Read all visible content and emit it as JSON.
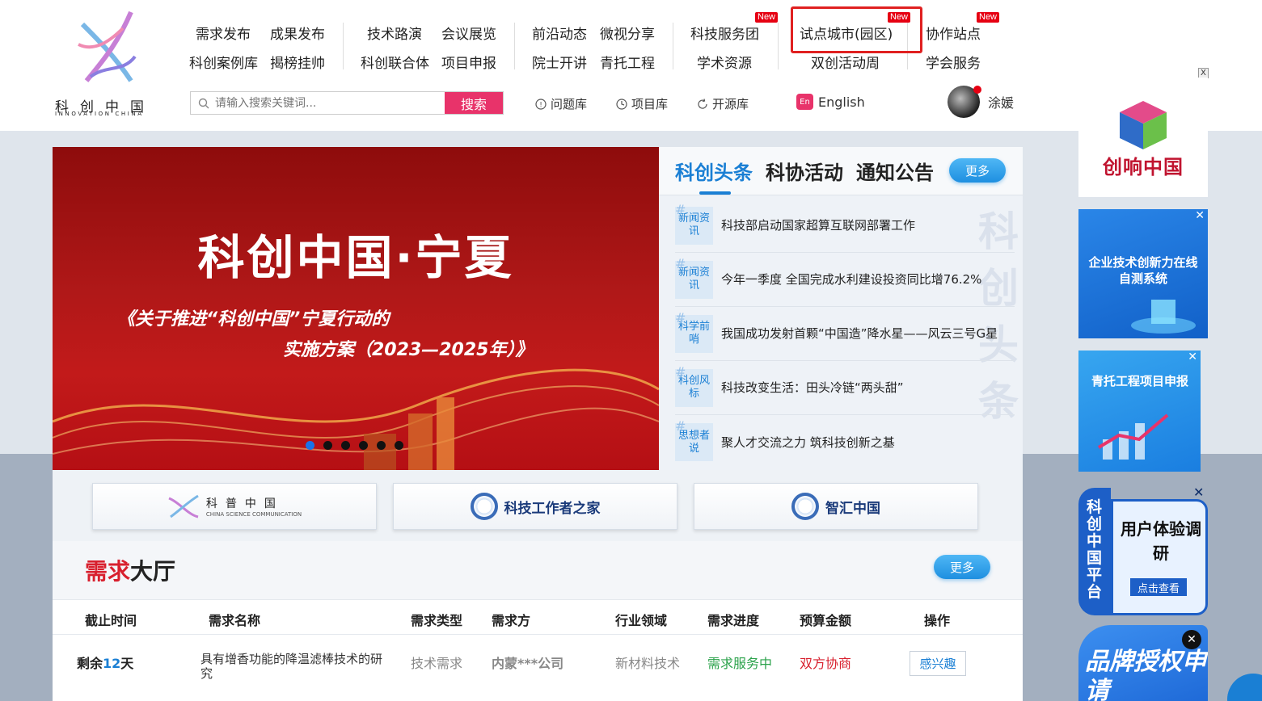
{
  "logo": {
    "cn": "科创中国",
    "en": "INNOVATION CHINA"
  },
  "nav": {
    "row1": [
      "需求发布",
      "成果发布",
      "技术路演",
      "会议展览",
      "前沿动态",
      "微视分享",
      "科技服务团",
      "试点城市(园区)",
      "协作站点"
    ],
    "row2": [
      "科创案例库",
      "揭榜挂帅",
      "科创联合体",
      "项目申报",
      "院士开讲",
      "青托工程",
      "学术资源",
      "双创活动周",
      "学会服务"
    ],
    "new_badge": "New"
  },
  "search": {
    "placeholder": "请输入搜索关键词...",
    "button": "搜索"
  },
  "libraries": [
    "问题库",
    "项目库",
    "开源库"
  ],
  "language": {
    "icon": "En",
    "label": "English"
  },
  "user": {
    "name": "涂媛"
  },
  "banner": {
    "title": "科创中国·宁夏",
    "subtitle_line1": "《关于推进“科创中国”宁夏行动的",
    "subtitle_line2": "实施方案（2023—2025年）》",
    "slide_count": 6,
    "active_slide": 0
  },
  "news": {
    "tabs": [
      "科创头条",
      "科协活动",
      "通知公告"
    ],
    "more": "更多",
    "watermark": "科创头条",
    "items": [
      {
        "tag": "新闻资讯",
        "title": "科技部启动国家超算互联网部署工作"
      },
      {
        "tag": "新闻资讯",
        "title": "今年一季度 全国完成水利建设投资同比增76.2%"
      },
      {
        "tag": "科学前哨",
        "title": "我国成功发射首颗“中国造”降水星——风云三号G星"
      },
      {
        "tag": "科创风标",
        "title": "科技改变生活：田头冷链“两头甜”"
      },
      {
        "tag": "思想者说",
        "title": "聚人才交流之力 筑科技创新之基"
      }
    ]
  },
  "partners": [
    {
      "label": "科普中国",
      "sub": "CHINA SCIENCE COMMUNICATION"
    },
    {
      "label": "科技工作者之家"
    },
    {
      "label": "智汇中国"
    }
  ],
  "hall": {
    "title_red": "需求",
    "title_rest": "大厅",
    "more": "更多",
    "headers": [
      "截止时间",
      "需求名称",
      "需求类型",
      "需求方",
      "行业领域",
      "需求进度",
      "预算金额",
      "操作"
    ],
    "rows": [
      {
        "deadline_prefix": "剩余",
        "deadline_days": "12",
        "deadline_suffix": "天",
        "name_line1": "具有增香功能的降温滤棒技术的研",
        "name_line2": "究",
        "type": "技术需求",
        "party": "内蒙***公司",
        "field": "新材料技术",
        "status": "需求服务中",
        "budget": "双方协商",
        "action": "感兴趣"
      }
    ]
  },
  "side_ads": {
    "close": "X",
    "ad1": "创响中国",
    "ad2": "企业技术创新力在线自测系统",
    "ad3": "青托工程项目申报",
    "ad4_vertical": "科创中国平台",
    "ad4_title": "用户体验调研",
    "ad4_button": "点击查看",
    "ad5": "品牌授权申请"
  },
  "colors": {
    "accent_pink": "#e8336a",
    "accent_blue": "#1a7fd4",
    "brand_red": "#d8202e",
    "status_green": "#2aa24a"
  }
}
